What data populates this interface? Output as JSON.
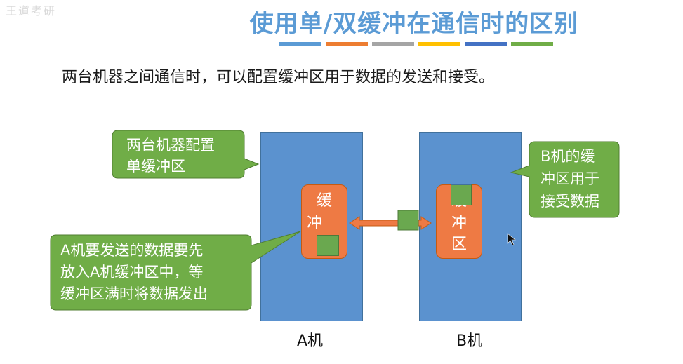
{
  "watermark": "王道考研",
  "title": "使用单/双缓冲在通信时的区别",
  "colors": [
    "#5b9bd5",
    "#ed7d31",
    "#a5a5a5",
    "#ffc000",
    "#4472c4",
    "#70ad47"
  ],
  "subtitle": "两台机器之间通信时，可以配置缓冲区用于数据的发送和接受。",
  "machine_a": {
    "label": "A机",
    "buffer_lines": [
      "缓",
      "冲"
    ]
  },
  "machine_b": {
    "label": "B机",
    "buffer_lines": [
      "缓",
      "冲",
      "区"
    ]
  },
  "callouts": {
    "config": [
      "两台机器配置",
      "单缓冲区"
    ],
    "send": [
      "A机要发送的数据要先",
      "放入A机缓冲区中，等",
      "缓冲区满时将数据发出"
    ],
    "receive": [
      "B机的缓",
      "冲区用于",
      "接受数据"
    ]
  }
}
